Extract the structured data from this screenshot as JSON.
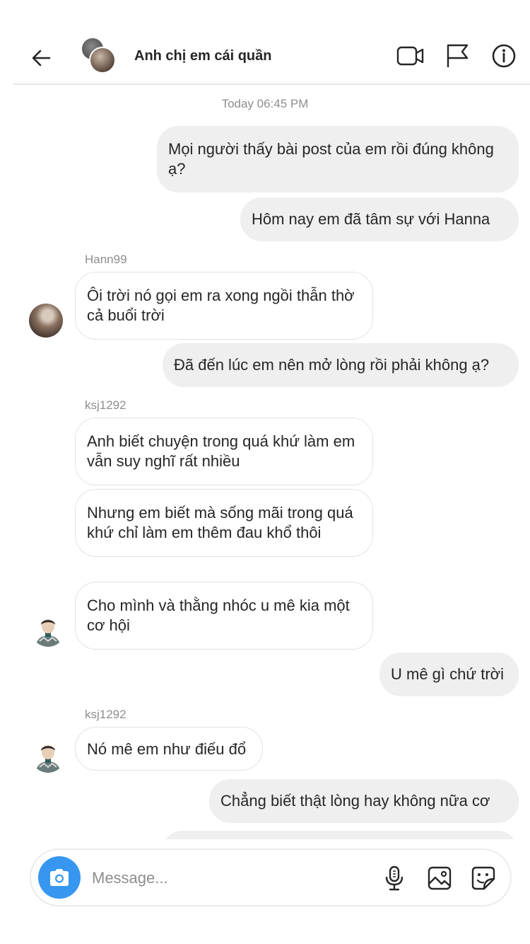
{
  "header": {
    "title": "Anh chị em cái quần",
    "icons": [
      "back-arrow-icon",
      "video-call-icon",
      "flag-icon",
      "info-icon"
    ]
  },
  "thread": {
    "timestamp": "Today 06:45 PM",
    "messages": [
      {
        "from": "me",
        "text": "Mọi người thấy bài post của em rồi đúng không ạ?"
      },
      {
        "from": "me",
        "text": "Hôm nay em đã tâm sự với Hanna"
      },
      {
        "from": "Hann99",
        "sender_label": "Hann99",
        "text": "Ôi trời nó gọi em ra xong ngồi thẫn thờ cả buổi trời"
      },
      {
        "from": "me",
        "text": "Đã đến lúc em nên mở lòng rồi phải không ạ?"
      },
      {
        "from": "ksj1292",
        "sender_label": "ksj1292",
        "text": "Anh biết chuyện trong quá khứ làm em vẫn suy nghĩ rất nhiều"
      },
      {
        "from": "ksj1292",
        "text": "Nhưng em biết mà sống mãi trong quá khứ chỉ làm em thêm đau khổ thôi"
      },
      {
        "from": "ksj1292",
        "text": "Cho mình và thằng nhóc u mê kia một cơ hội"
      },
      {
        "from": "me",
        "text": "U mê gì chứ trời"
      },
      {
        "from": "ksj1292",
        "sender_label": "ksj1292",
        "text": "Nó mê em như điếu đổ"
      },
      {
        "from": "me",
        "text": "Chẳng biết thật lòng hay không nữa cơ"
      }
    ]
  },
  "composer": {
    "placeholder": "Message...",
    "icons": [
      "camera-icon",
      "microphone-icon",
      "gallery-icon",
      "sticker-icon"
    ]
  },
  "colors": {
    "accent": "#3797f0",
    "outgoing_bubble": "#efefef",
    "muted_text": "#8e8e8e"
  }
}
